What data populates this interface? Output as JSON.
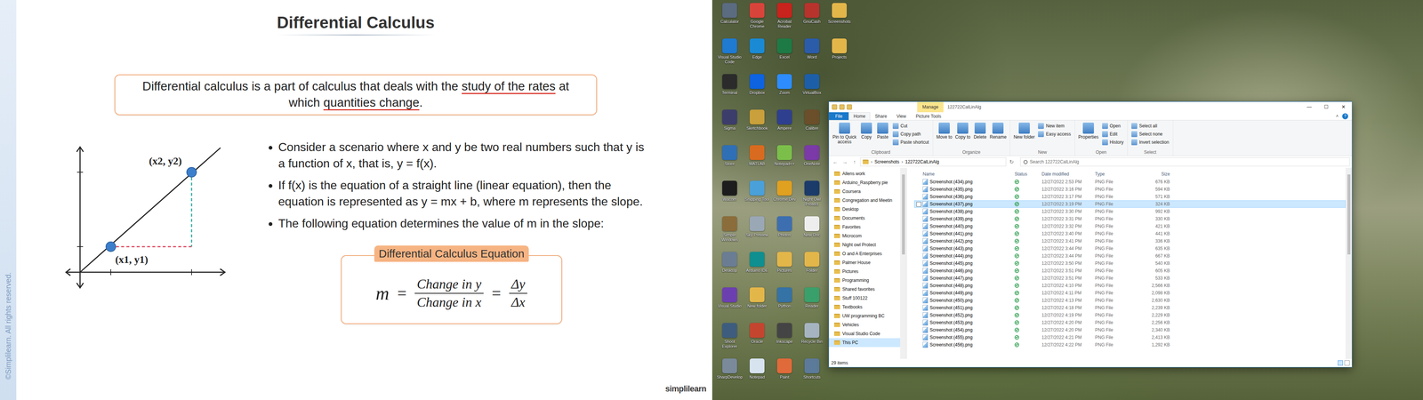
{
  "slide": {
    "title": "Differential Calculus",
    "watermark": "©Simplilearn. All rights reserved.",
    "definition": [
      {
        "text": "Differential calculus is a part of calculus that deals with the ",
        "annotated": false
      },
      {
        "text": "study of the rates",
        "annotated": true
      },
      {
        "text": " at which ",
        "annotated": false
      },
      {
        "text": "quantities change",
        "annotated": true
      },
      {
        "text": ".",
        "annotated": false
      }
    ],
    "graph": {
      "point2": "(x2, y2)",
      "point1": "(x1, y1)"
    },
    "bullets": [
      "Consider a scenario where x and y be two real numbers such that y is a function of x, that is, y = f(x).",
      "If f(x) is the equation of a straight line (linear equation), then the equation is represented as y = mx + b, where m represents the slope.",
      "The following equation determines the value of m in the slope:"
    ],
    "equation": {
      "heading": "Differential Calculus Equation",
      "lhs": "m",
      "equals": "=",
      "fraction1": {
        "numerator": "Change in y",
        "denominator": "Change in x"
      },
      "fraction2": {
        "numerator": "Δy",
        "denominator": "Δx"
      }
    },
    "logo": "simplilearn"
  },
  "desktop": {
    "icons": [
      {
        "label": "Calculator",
        "color": "#5b6b80"
      },
      {
        "label": "Visual Studio Code",
        "color": "#1f7ad1"
      },
      {
        "label": "Terminal",
        "color": "#2b2b2b"
      },
      {
        "label": "Sigma",
        "color": "#3d3d6b"
      },
      {
        "label": "Store",
        "color": "#2f6fb5"
      },
      {
        "label": "Wacom",
        "color": "#1d1d1d"
      },
      {
        "label": "Simple Windows",
        "color": "#8a6d3b"
      },
      {
        "label": "Desktop",
        "color": "#6a7d93"
      },
      {
        "label": "Visual Studio",
        "color": "#6c3fb0"
      },
      {
        "label": "Shoot Explorer",
        "color": "#3e5d7e"
      },
      {
        "label": "SharpDevelop",
        "color": "#7a8a9a"
      },
      {
        "label": "Google Chrome",
        "color": "#d9443a"
      },
      {
        "label": "Edge",
        "color": "#1a8ad4"
      },
      {
        "label": "Dropbox",
        "color": "#0d63e0"
      },
      {
        "label": "Sketchbook",
        "color": "#c9a03b"
      },
      {
        "label": "MATLAB",
        "color": "#d86b1f"
      },
      {
        "label": "Snipping Tool",
        "color": "#4aa0d8"
      },
      {
        "label": "Sky Preview",
        "color": "#9aa7b4"
      },
      {
        "label": "Arduino IDE",
        "color": "#0f8f8f"
      },
      {
        "label": "New folder",
        "color": "#e3b64a"
      },
      {
        "label": "Oracle",
        "color": "#c4452f"
      },
      {
        "label": "Notepad",
        "color": "#d7e3ee"
      },
      {
        "label": "Acrobat Reader",
        "color": "#c8231c"
      },
      {
        "label": "Excel",
        "color": "#1e7a44"
      },
      {
        "label": "Zoom",
        "color": "#2d8cff"
      },
      {
        "label": "Ampere",
        "color": "#2f3f8f"
      },
      {
        "label": "Notepad++",
        "color": "#7bbf4a"
      },
      {
        "label": "Chrome Dev",
        "color": "#e0a020"
      },
      {
        "label": "Photos",
        "color": "#3d6fb0"
      },
      {
        "label": "Pictures",
        "color": "#e3b64a"
      },
      {
        "label": "Python",
        "color": "#3572a5"
      },
      {
        "label": "Inkscape",
        "color": "#444444"
      },
      {
        "label": "Paint",
        "color": "#e06a3a"
      },
      {
        "label": "GnuCash",
        "color": "#b8332c"
      },
      {
        "label": "Word",
        "color": "#2b5caa"
      },
      {
        "label": "VirtualBox",
        "color": "#1c5fa8"
      },
      {
        "label": "Calibre",
        "color": "#6b4f2a"
      },
      {
        "label": "OneNote",
        "color": "#7b3aa8"
      },
      {
        "label": "Night Owl Protect",
        "color": "#1b3b6b"
      },
      {
        "label": "New Doc",
        "color": "#eeeeee"
      },
      {
        "label": "Folder",
        "color": "#e3b64a"
      },
      {
        "label": "Reader",
        "color": "#3aa06b"
      },
      {
        "label": "Recycle Bin",
        "color": "#a6b4c2"
      },
      {
        "label": "Shortcuts",
        "color": "#5c7a99"
      },
      {
        "label": "Screenshots",
        "color": "#e3b64a"
      },
      {
        "label": "Projects",
        "color": "#e3b64a"
      }
    ]
  },
  "explorer": {
    "title": "122722CalLinAlg",
    "context_tab": "Manage",
    "controls": [
      "—",
      "☐",
      "✕"
    ],
    "tabs": [
      {
        "label": "File",
        "selected": false,
        "kind": "file"
      },
      {
        "label": "Home",
        "selected": true,
        "kind": "tab"
      },
      {
        "label": "Share",
        "selected": false,
        "kind": "tab"
      },
      {
        "label": "View",
        "selected": false,
        "kind": "tab"
      },
      {
        "label": "Picture Tools",
        "selected": false,
        "kind": "tab"
      }
    ],
    "tab_extras": [
      "˄",
      "?"
    ],
    "ribbon": [
      {
        "group": "Clipboard",
        "buttons": [
          {
            "label": "Pin to Quick access",
            "kind": "large"
          },
          {
            "label": "Copy",
            "kind": "large"
          },
          {
            "label": "Paste",
            "kind": "large"
          },
          {
            "label": "Cut",
            "kind": "small"
          },
          {
            "label": "Copy path",
            "kind": "small"
          },
          {
            "label": "Paste shortcut",
            "kind": "small"
          }
        ]
      },
      {
        "group": "Organize",
        "buttons": [
          {
            "label": "Move to",
            "kind": "large"
          },
          {
            "label": "Copy to",
            "kind": "large"
          },
          {
            "label": "Delete",
            "kind": "large"
          },
          {
            "label": "Rename",
            "kind": "large"
          }
        ]
      },
      {
        "group": "New",
        "buttons": [
          {
            "label": "New folder",
            "kind": "large"
          },
          {
            "label": "New item",
            "kind": "small"
          },
          {
            "label": "Easy access",
            "kind": "small"
          }
        ]
      },
      {
        "group": "Open",
        "buttons": [
          {
            "label": "Properties",
            "kind": "large"
          },
          {
            "label": "Open",
            "kind": "small"
          },
          {
            "label": "Edit",
            "kind": "small"
          },
          {
            "label": "History",
            "kind": "small"
          }
        ]
      },
      {
        "group": "Select",
        "buttons": [
          {
            "label": "Select all",
            "kind": "small"
          },
          {
            "label": "Select none",
            "kind": "small"
          },
          {
            "label": "Invert selection",
            "kind": "small"
          }
        ]
      }
    ],
    "address": {
      "back": "←",
      "forward": "→",
      "up": "↑",
      "crumbs": [
        "Screenshots",
        "122722CalLinAlg"
      ],
      "separator": "›",
      "refresh": "↻"
    },
    "search": {
      "placeholder": "Search 122722CalLinAlg"
    },
    "nav": [
      {
        "label": "Allens work",
        "selected": false
      },
      {
        "label": "Arduino_Raspberry pie",
        "selected": false
      },
      {
        "label": "Coursera",
        "selected": false
      },
      {
        "label": "Congregation and Meetin",
        "selected": false
      },
      {
        "label": "Desktop",
        "selected": false
      },
      {
        "label": "Documents",
        "selected": false
      },
      {
        "label": "Favorites",
        "selected": false
      },
      {
        "label": "Microcom",
        "selected": false
      },
      {
        "label": "Night owl Protect",
        "selected": false
      },
      {
        "label": "O and A Enterprises",
        "selected": false
      },
      {
        "label": "Palmer House",
        "selected": false
      },
      {
        "label": "Pictures",
        "selected": false
      },
      {
        "label": "Programming",
        "selected": false
      },
      {
        "label": "Shared favorites",
        "selected": false
      },
      {
        "label": "Stuff 100122",
        "selected": false
      },
      {
        "label": "Textbooks",
        "selected": false
      },
      {
        "label": "UW programming BC",
        "selected": false
      },
      {
        "label": "Vehicles",
        "selected": false
      },
      {
        "label": "Visual Studio Code",
        "selected": false
      },
      {
        "label": "This PC",
        "selected": true
      }
    ],
    "columns": [
      "Name",
      "Status",
      "Date modified",
      "Type",
      "Size"
    ],
    "rows": [
      {
        "name": "Screenshot (434).png",
        "date": "12/27/2022 2:53 PM",
        "type": "PNG File",
        "size": "676 KB",
        "selected": false,
        "synced": true
      },
      {
        "name": "Screenshot (435).png",
        "date": "12/27/2022 3:16 PM",
        "type": "PNG File",
        "size": "594 KB",
        "selected": false,
        "synced": true
      },
      {
        "name": "Screenshot (436).png",
        "date": "12/27/2022 3:17 PM",
        "type": "PNG File",
        "size": "571 KB",
        "selected": false,
        "synced": true
      },
      {
        "name": "Screenshot (437).png",
        "date": "12/27/2022 3:19 PM",
        "type": "PNG File",
        "size": "324 KB",
        "selected": true,
        "synced": true
      },
      {
        "name": "Screenshot (438).png",
        "date": "12/27/2022 3:30 PM",
        "type": "PNG File",
        "size": "992 KB",
        "selected": false,
        "synced": true
      },
      {
        "name": "Screenshot (439).png",
        "date": "12/27/2022 3:31 PM",
        "type": "PNG File",
        "size": "330 KB",
        "selected": false,
        "synced": true
      },
      {
        "name": "Screenshot (440).png",
        "date": "12/27/2022 3:32 PM",
        "type": "PNG File",
        "size": "421 KB",
        "selected": false,
        "synced": true
      },
      {
        "name": "Screenshot (441).png",
        "date": "12/27/2022 3:40 PM",
        "type": "PNG File",
        "size": "441 KB",
        "selected": false,
        "synced": true
      },
      {
        "name": "Screenshot (442).png",
        "date": "12/27/2022 3:41 PM",
        "type": "PNG File",
        "size": "336 KB",
        "selected": false,
        "synced": true
      },
      {
        "name": "Screenshot (443).png",
        "date": "12/27/2022 3:44 PM",
        "type": "PNG File",
        "size": "635 KB",
        "selected": false,
        "synced": true
      },
      {
        "name": "Screenshot (444).png",
        "date": "12/27/2022 3:44 PM",
        "type": "PNG File",
        "size": "667 KB",
        "selected": false,
        "synced": true
      },
      {
        "name": "Screenshot (445).png",
        "date": "12/27/2022 3:50 PM",
        "type": "PNG File",
        "size": "540 KB",
        "selected": false,
        "synced": true
      },
      {
        "name": "Screenshot (446).png",
        "date": "12/27/2022 3:51 PM",
        "type": "PNG File",
        "size": "605 KB",
        "selected": false,
        "synced": true
      },
      {
        "name": "Screenshot (447).png",
        "date": "12/27/2022 3:51 PM",
        "type": "PNG File",
        "size": "533 KB",
        "selected": false,
        "synced": true
      },
      {
        "name": "Screenshot (448).png",
        "date": "12/27/2022 4:10 PM",
        "type": "PNG File",
        "size": "2,566 KB",
        "selected": false,
        "synced": true
      },
      {
        "name": "Screenshot (449).png",
        "date": "12/27/2022 4:11 PM",
        "type": "PNG File",
        "size": "2,098 KB",
        "selected": false,
        "synced": true
      },
      {
        "name": "Screenshot (450).png",
        "date": "12/27/2022 4:13 PM",
        "type": "PNG File",
        "size": "2,630 KB",
        "selected": false,
        "synced": true
      },
      {
        "name": "Screenshot (451).png",
        "date": "12/27/2022 4:18 PM",
        "type": "PNG File",
        "size": "2,239 KB",
        "selected": false,
        "synced": true
      },
      {
        "name": "Screenshot (452).png",
        "date": "12/27/2022 4:19 PM",
        "type": "PNG File",
        "size": "2,229 KB",
        "selected": false,
        "synced": true
      },
      {
        "name": "Screenshot (453).png",
        "date": "12/27/2022 4:20 PM",
        "type": "PNG File",
        "size": "2,256 KB",
        "selected": false,
        "synced": true
      },
      {
        "name": "Screenshot (454).png",
        "date": "12/27/2022 4:20 PM",
        "type": "PNG File",
        "size": "2,340 KB",
        "selected": false,
        "synced": true
      },
      {
        "name": "Screenshot (455).png",
        "date": "12/27/2022 4:21 PM",
        "type": "PNG File",
        "size": "2,413 KB",
        "selected": false,
        "synced": true
      },
      {
        "name": "Screenshot (456).png",
        "date": "12/27/2022 4:22 PM",
        "type": "PNG File",
        "size": "1,292 KB",
        "selected": false,
        "synced": true
      }
    ],
    "status_bar": "29 items"
  }
}
